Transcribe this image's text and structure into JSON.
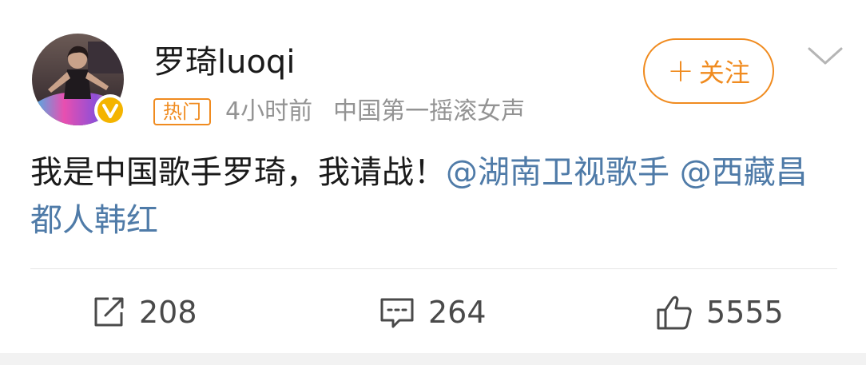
{
  "post": {
    "author": {
      "name": "罗琦luoqi",
      "verified_icon": "verified-v-icon"
    },
    "badge": "热门",
    "time": "4小时前",
    "source": "中国第一摇滚女声",
    "follow_label": "关注",
    "follow_plus": "+",
    "text": "我是中国歌手罗琦，我请战！",
    "mentions": [
      "@湖南卫视歌手",
      "@西藏昌都人韩红"
    ]
  },
  "actions": {
    "repost_count": "208",
    "comment_count": "264",
    "like_count": "5555"
  },
  "colors": {
    "accent": "#f08b1f",
    "link": "#4f7ba8",
    "meta": "#939393",
    "verified": "#f4b400"
  }
}
